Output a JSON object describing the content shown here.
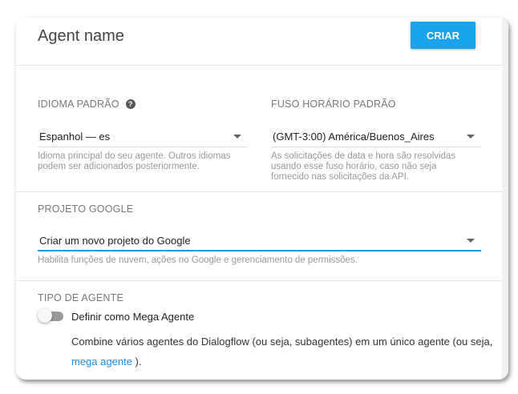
{
  "header": {
    "title": "Agent name",
    "create_label": "CRIAR"
  },
  "language": {
    "label": "IDIOMA PADRÃO",
    "help_icon": "?",
    "value": "Espanhol — es",
    "helper": "Idioma principal do seu agente. Outros idiomas podem ser adicionados posteriormente."
  },
  "timezone": {
    "label": "FUSO HORÁRIO PADRÃO",
    "value": "(GMT-3:00) América/Buenos_Aires",
    "helper": "As solicitações de data e hora são resolvidas usando esse fuso horário, caso não seja fornecido nas solicitações da API."
  },
  "project": {
    "label": "PROJETO GOOGLE",
    "value": "Criar um novo projeto do Google",
    "helper": "Habilita funções de nuvem, ações no Google e gerenciamento de permissões."
  },
  "agent_type": {
    "label": "TIPO DE AGENTE",
    "toggle_label": "Definir como Mega Agente",
    "toggle_on": false,
    "description": "Combine vários agentes do Dialogflow (ou seja, subagentes) em um único agente (ou seja,",
    "link": "mega agente",
    "suffix": " )."
  },
  "colors": {
    "accent": "#1aa3ec",
    "link": "#1a8ee0"
  }
}
